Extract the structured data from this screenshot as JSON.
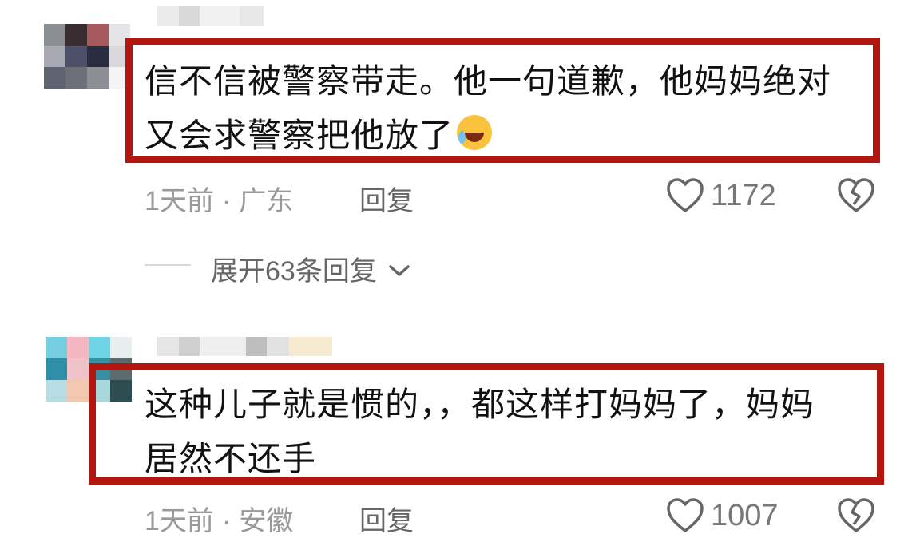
{
  "comments": [
    {
      "text_line1": "信不信被警察带走。他一句道歉，他妈妈绝对",
      "text_line2": "又会求警察把他放了",
      "time": "1天前",
      "separator": "·",
      "location": "广东",
      "reply_label": "回复",
      "likes": "1172",
      "emoji_icon": "laughing-crying-emoji",
      "avatar_colors": [
        "#8a8d92",
        "#3a2d2f",
        "#a7595c",
        "#e4e4e6",
        "#a9a9b3",
        "#4e4f68",
        "#2a2d3f",
        "#d7d7dc",
        "#5f6370",
        "#6f6f7a",
        "#8d8d95",
        "#f3f3f5"
      ]
    },
    {
      "text_line1": "这种儿子就是惯的，，都这样打妈妈了，妈妈",
      "text_line2": "居然不还手",
      "time": "1天前",
      "separator": "·",
      "location": "安徽",
      "reply_label": "回复",
      "likes": "1007",
      "avatar_colors": [
        "#76cfe0",
        "#f4b6c1",
        "#6fd3e6",
        "#e8eef0",
        "#2e8fa8",
        "#f0c3c9",
        "#3b8ea0",
        "#5b6a6d",
        "#b7dde2",
        "#f2c9b0",
        "#a9d8dc",
        "#2d4d50"
      ]
    }
  ],
  "expand_replies_label": "展开63条回复",
  "colors": {
    "highlight": "#b3160f",
    "meta": "#9a9a9a"
  }
}
